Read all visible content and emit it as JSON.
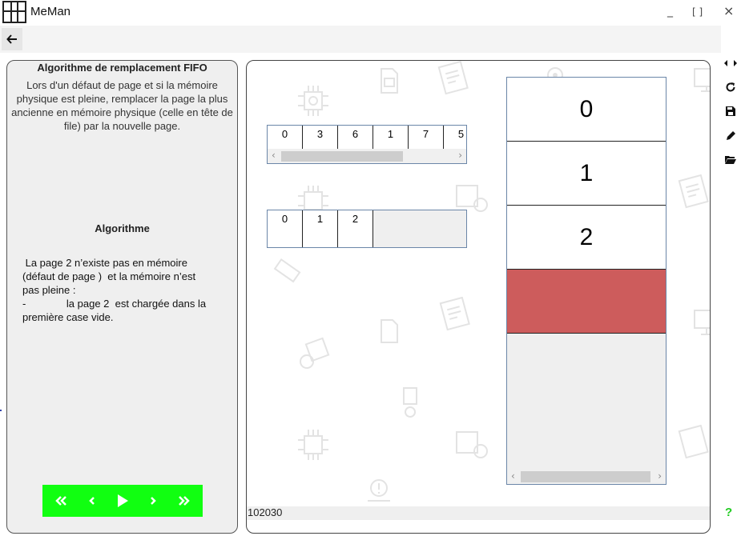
{
  "window": {
    "title": "MeMan",
    "controls": {
      "minimize": "_",
      "maximize": "[ ]",
      "close": "×"
    }
  },
  "description_panel": {
    "title": "Algorithme de remplacement FIFO",
    "description": "Lors d'un défaut de page et si la mémoire physique est pleine, remplacer la page la plus ancienne en mémoire physique (celle en tête de file) par la nouvelle page.",
    "algorithm_heading": "Algorithme",
    "step_lines": [
      " La page 2 n’existe pas en mémoire",
      "(défaut de page )  et la mémoire n’est",
      "pas pleine :",
      "-              la page 2  est chargée dans la",
      "première case vide."
    ],
    "controls": [
      "first-icon",
      "previous-icon",
      "play-icon",
      "next-icon",
      "last-icon"
    ]
  },
  "simulation": {
    "reference_string": [
      "0",
      "3",
      "6",
      "1",
      "7",
      "5"
    ],
    "frames": [
      "0",
      "1",
      "2"
    ],
    "memory_pages": [
      "0",
      "1",
      "2",
      ""
    ],
    "status_text": "102030"
  },
  "side_toolbar": {
    "icons": [
      "resize-horizontal-icon",
      "refresh-icon",
      "save-icon",
      "edit-icon",
      "open-folder-icon"
    ],
    "help": "?"
  },
  "colors": {
    "controls_bg": "#11ff11",
    "highlight_frame": "#cd5c5c",
    "help": "#22cc22",
    "scroll_border": "#6b86a8"
  }
}
